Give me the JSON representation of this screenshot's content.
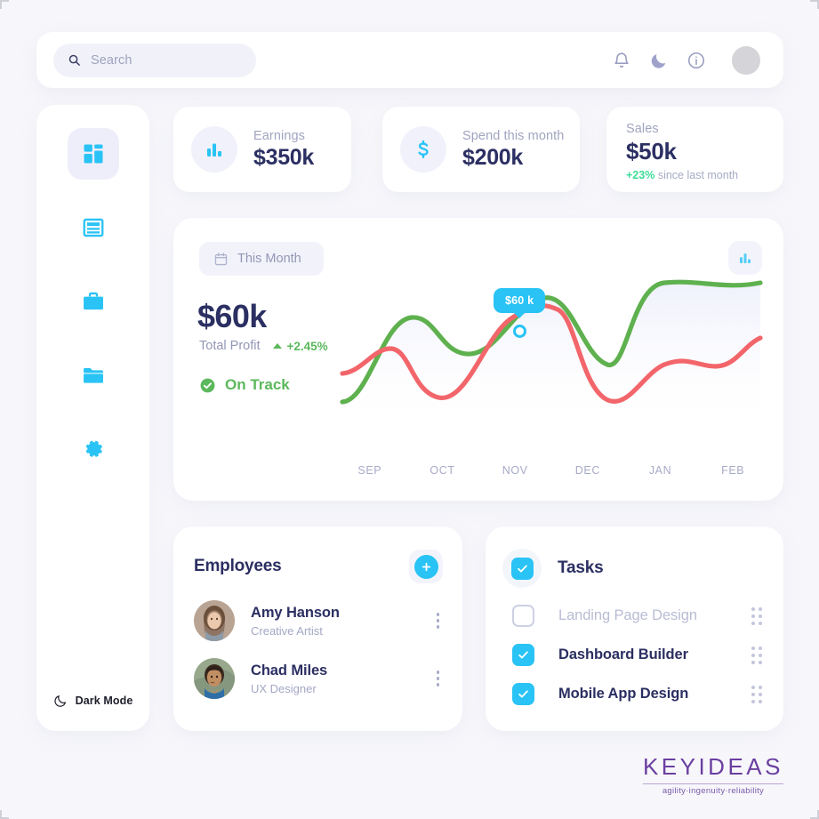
{
  "search": {
    "placeholder": "Search",
    "icon": "search-icon"
  },
  "topbar": {
    "icons": [
      {
        "name": "bell-icon",
        "label": "Notifications"
      },
      {
        "name": "moon-icon",
        "label": "Dark mode"
      },
      {
        "name": "info-icon",
        "label": "Info"
      }
    ],
    "avatar": "user-avatar"
  },
  "sidebar": {
    "items": [
      {
        "name": "dashboard-icon",
        "label": "Dashboard",
        "active": true
      },
      {
        "name": "document-icon",
        "label": "Documents",
        "active": false
      },
      {
        "name": "briefcase-icon",
        "label": "Projects",
        "active": false
      },
      {
        "name": "folder-icon",
        "label": "Files",
        "active": false
      },
      {
        "name": "gear-icon",
        "label": "Settings",
        "active": false
      }
    ],
    "dark_mode_label": "Dark Mode"
  },
  "stats": [
    {
      "label": "Earnings",
      "value": "$350k",
      "icon": "bar-chart-icon"
    },
    {
      "label": "Spend this month",
      "value": "$200k",
      "icon": "dollar-icon"
    },
    {
      "label": "Sales",
      "value": "$50k",
      "delta": "+23%",
      "delta_suffix": "since last month"
    }
  ],
  "chart_panel": {
    "period": "This Month",
    "period_icon": "calendar-icon",
    "panel_icon": "bar-chart-icon",
    "amount": "$60k",
    "amount_label": "Total Profit",
    "change": "+2.45%",
    "status": "On Track",
    "tooltip": "$60 k"
  },
  "chart_data": {
    "type": "line",
    "title": "Total Profit",
    "xlabel": "",
    "ylabel": "",
    "categories": [
      "SEP",
      "OCT",
      "NOV",
      "DEC",
      "JAN",
      "FEB"
    ],
    "legend_position": "none",
    "grid": false,
    "highlight": {
      "series": "Profit",
      "x": "NOV",
      "value": "$60 k",
      "label": "$60 k"
    },
    "series": [
      {
        "name": "Profit",
        "color": "#5eb14e",
        "values": [
          18,
          52,
          40,
          62,
          34,
          76,
          70,
          74
        ],
        "x": [
          0,
          14,
          28,
          43,
          58,
          72,
          86,
          100
        ]
      },
      {
        "name": "Spend",
        "color": "#f2666b",
        "values": [
          30,
          42,
          16,
          38,
          64,
          50,
          18,
          40,
          36,
          52
        ],
        "x": [
          0,
          11,
          22,
          36,
          48,
          57,
          68,
          78,
          88,
          100
        ]
      }
    ]
  },
  "employees": {
    "title": "Employees",
    "add_label": "+",
    "list": [
      {
        "name": "Amy Hanson",
        "role": "Creative Artist"
      },
      {
        "name": "Chad Miles",
        "role": "UX Designer"
      }
    ]
  },
  "tasks": {
    "title": "Tasks",
    "list": [
      {
        "label": "Landing Page Design",
        "done": false
      },
      {
        "label": "Dashboard Builder",
        "done": true
      },
      {
        "label": "Mobile App Design",
        "done": true
      }
    ]
  },
  "logo": {
    "name": "KEYIDEAS",
    "tagline": "agility·ingenuity·reliability"
  },
  "colors": {
    "accent": "#29c3f5",
    "green": "#5cb85c",
    "red": "#f2666b",
    "navy": "#2b2f62",
    "background": "#f7f7fb"
  }
}
